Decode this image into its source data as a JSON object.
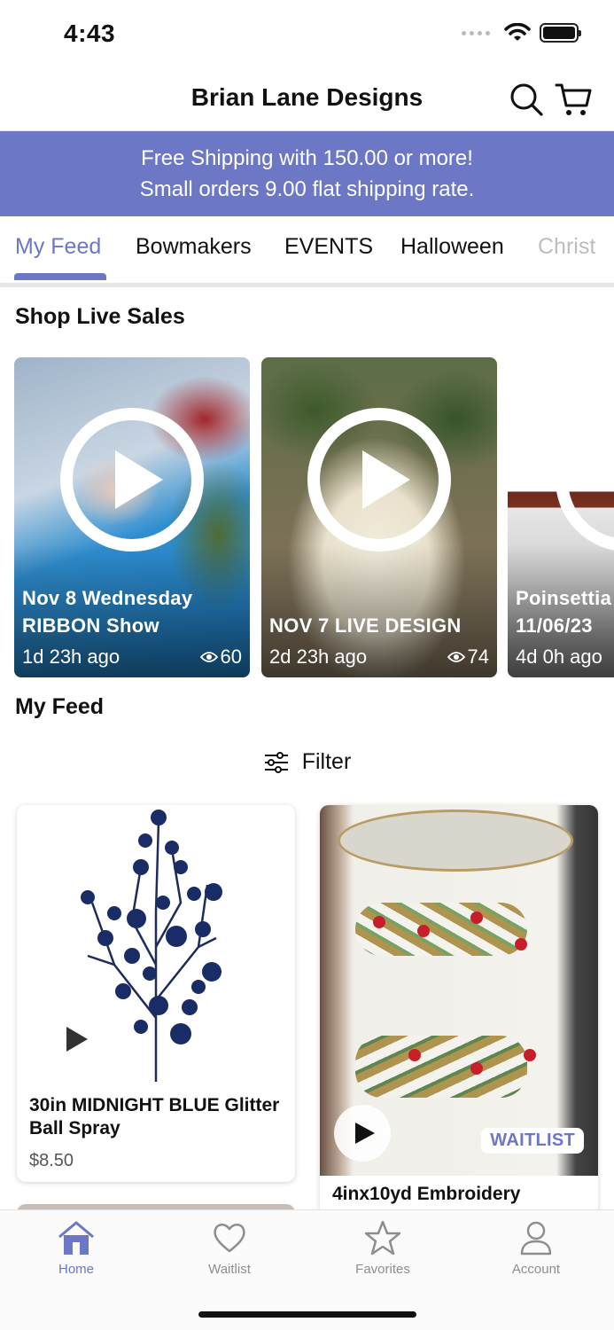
{
  "status": {
    "time": "4:43"
  },
  "header": {
    "title": "Brian Lane Designs"
  },
  "banner": {
    "line1": "Free Shipping with 150.00 or more!",
    "line2": "Small orders 9.00 flat shipping rate."
  },
  "tabs": [
    "My Feed",
    "Bowmakers",
    "EVENTS",
    "Halloween",
    "Christ"
  ],
  "live_sales": {
    "title": "Shop Live Sales",
    "cards": [
      {
        "title_line1": "Nov 8 Wednesday",
        "title_line2": "RIBBON Show",
        "time": "1d 23h ago",
        "views": "60"
      },
      {
        "title_line1": "NOV 7 LIVE DESIGN",
        "time": "2d 23h ago",
        "views": "74"
      },
      {
        "title_line1": "Poinsettia",
        "title_line2": "11/06/23",
        "time": "4d 0h ago"
      }
    ]
  },
  "feed": {
    "title": "My Feed",
    "filter_label": "Filter",
    "products": [
      {
        "name": "30in MIDNIGHT BLUE Glitter Ball Spray",
        "price": "$8.50"
      },
      {
        "name": "4inx10yd Embroidery",
        "badge": "WAITLIST"
      }
    ]
  },
  "bottom_nav": [
    {
      "label": "Home",
      "icon": "home-icon"
    },
    {
      "label": "Waitlist",
      "icon": "heart-icon"
    },
    {
      "label": "Favorites",
      "icon": "star-icon"
    },
    {
      "label": "Account",
      "icon": "person-icon"
    }
  ],
  "colors": {
    "accent": "#6c77c6",
    "banner": "#6c77c6"
  }
}
